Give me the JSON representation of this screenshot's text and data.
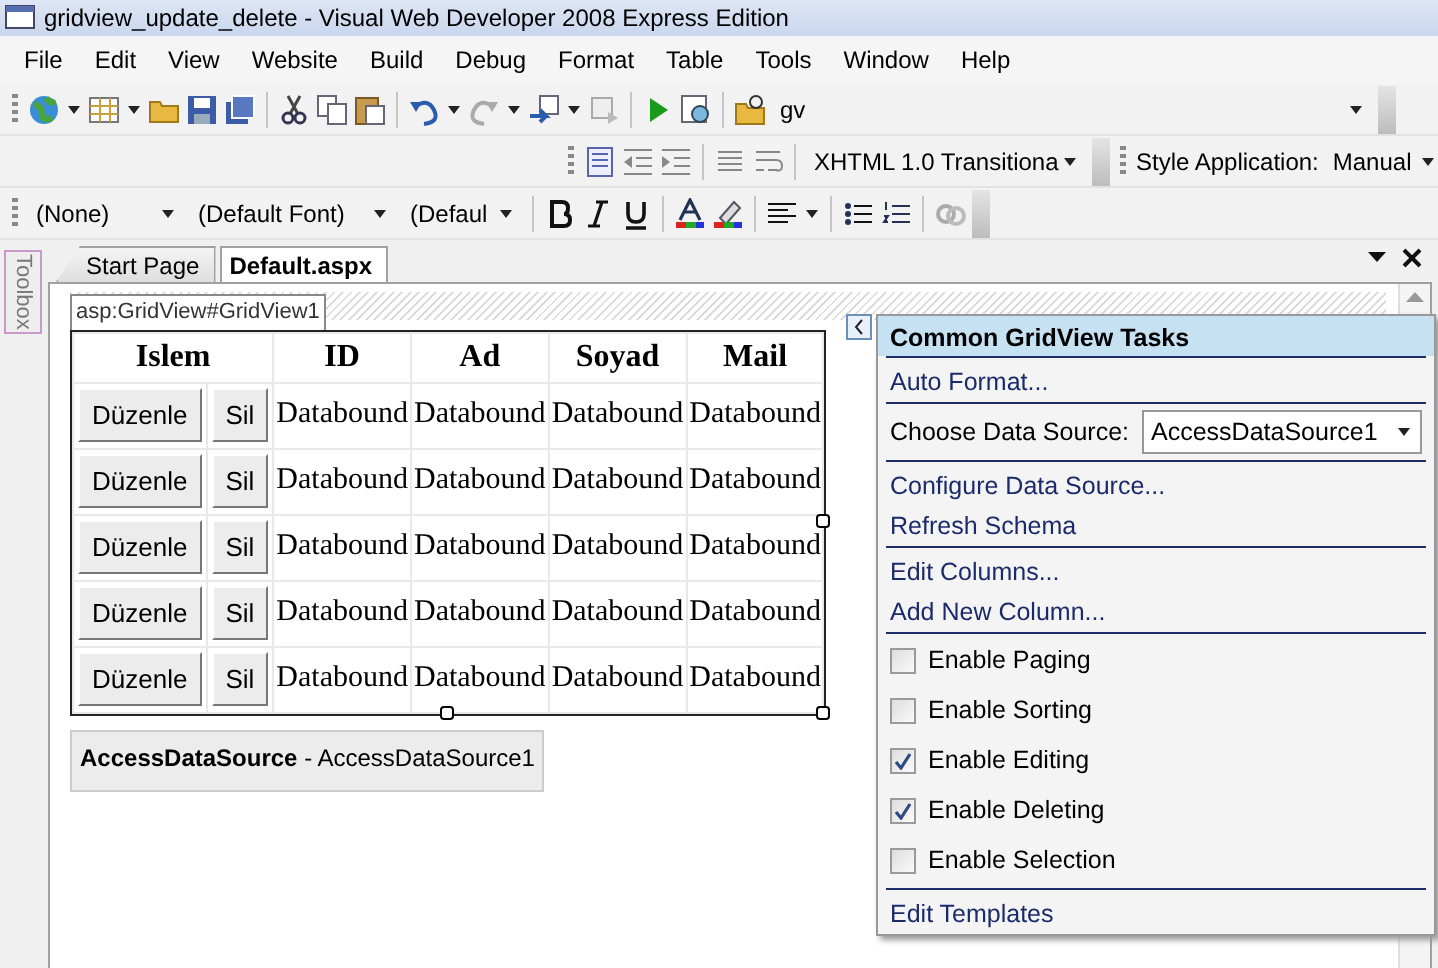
{
  "window": {
    "title": "gridview_update_delete - Visual Web Developer 2008 Express Edition"
  },
  "menu": [
    "File",
    "Edit",
    "View",
    "Website",
    "Build",
    "Debug",
    "Format",
    "Table",
    "Tools",
    "Window",
    "Help"
  ],
  "toolbars": {
    "target_combo": "gv",
    "doctype_combo": "XHTML 1.0 Transitiona",
    "style_label": "Style Application:",
    "style_value": "Manual",
    "block_combo": "(None)",
    "font_combo": "(Default Font)",
    "size_combo": "(Defaul"
  },
  "toolbox": {
    "label": "Toolbox"
  },
  "tabs": [
    {
      "label": "Start Page",
      "selected": false
    },
    {
      "label": "Default.aspx",
      "selected": true
    }
  ],
  "tag_label": "asp:GridView#GridView1",
  "grid": {
    "columns": [
      {
        "label": "Islem",
        "colspan": 2
      },
      {
        "label": "ID"
      },
      {
        "label": "Ad"
      },
      {
        "label": "Soyad"
      },
      {
        "label": "Mail"
      }
    ],
    "rows": [
      {
        "cells": [
          "Düzenle",
          "Sil",
          "Databound",
          "Databound",
          "Databound",
          "Databound"
        ]
      },
      {
        "cells": [
          "Düzenle",
          "Sil",
          "Databound",
          "Databound",
          "Databound",
          "Databound"
        ]
      },
      {
        "cells": [
          "Düzenle",
          "Sil",
          "Databound",
          "Databound",
          "Databound",
          "Databound"
        ]
      },
      {
        "cells": [
          "Düzenle",
          "Sil",
          "Databound",
          "Databound",
          "Databound",
          "Databound"
        ]
      },
      {
        "cells": [
          "Düzenle",
          "Sil",
          "Databound",
          "Databound",
          "Databound",
          "Databound"
        ]
      }
    ]
  },
  "datasource_label": "**AccessDataSource** - AccessDataSource1",
  "smart_tag": {
    "title": "Common GridView Tasks",
    "groups": [
      [
        {
          "kind": "link",
          "label": "Auto Format..."
        }
      ],
      [
        {
          "kind": "select",
          "label": "Choose Data Source:",
          "value": "AccessDataSource1"
        }
      ],
      [
        {
          "kind": "link",
          "label": "Configure Data Source..."
        },
        {
          "kind": "link",
          "label": "Refresh Schema"
        }
      ],
      [
        {
          "kind": "link",
          "label": "Edit Columns..."
        },
        {
          "kind": "link",
          "label": "Add New Column..."
        }
      ],
      [
        {
          "kind": "checkbox",
          "label": "Enable Paging",
          "checked": false
        },
        {
          "kind": "checkbox",
          "label": "Enable Sorting",
          "checked": false
        },
        {
          "kind": "checkbox",
          "label": "Enable Editing",
          "checked": true
        },
        {
          "kind": "checkbox",
          "label": "Enable Deleting",
          "checked": true
        },
        {
          "kind": "checkbox",
          "label": "Enable Selection",
          "checked": false
        }
      ],
      [
        {
          "kind": "link",
          "label": "Edit Templates"
        }
      ]
    ]
  }
}
